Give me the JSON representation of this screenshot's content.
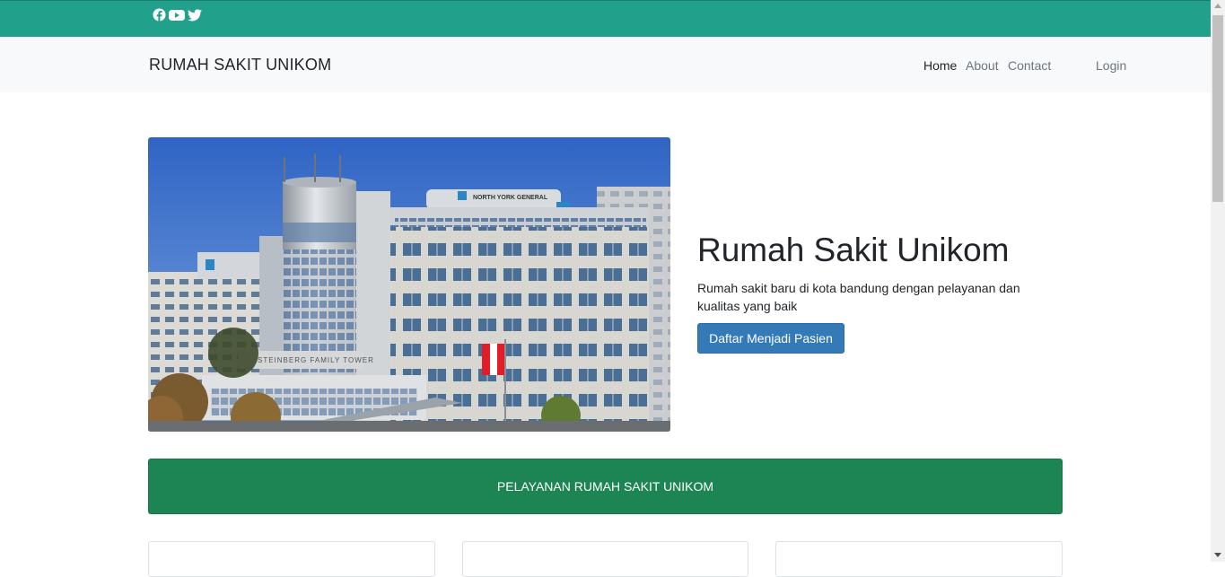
{
  "topbar": {
    "social": [
      {
        "icon": "facebook-icon"
      },
      {
        "icon": "youtube-icon"
      },
      {
        "icon": "twitter-icon"
      }
    ]
  },
  "navbar": {
    "brand": "RUMAH SAKIT UNIKOM",
    "links": [
      "Home",
      "About",
      "Contact"
    ],
    "active": "Home",
    "login": "Login"
  },
  "hero": {
    "title": "Rumah Sakit Unikom",
    "description": "Rumah sakit baru di kota bandung dengan pelayanan dan kualitas yang baik",
    "button": "Daftar Menjadi Pasien",
    "image_sign_main": "NORTH YORK GENERAL",
    "image_sign_tower": "STEINBERG FAMILY TOWER"
  },
  "services": {
    "banner": "PELAYANAN RUMAH SAKIT UNIKOM",
    "cards": 3
  },
  "colors": {
    "topbar": "#21a08b",
    "navbar": "#f8f9fa",
    "primary_button": "#337ab7",
    "banner": "#1c8553"
  }
}
